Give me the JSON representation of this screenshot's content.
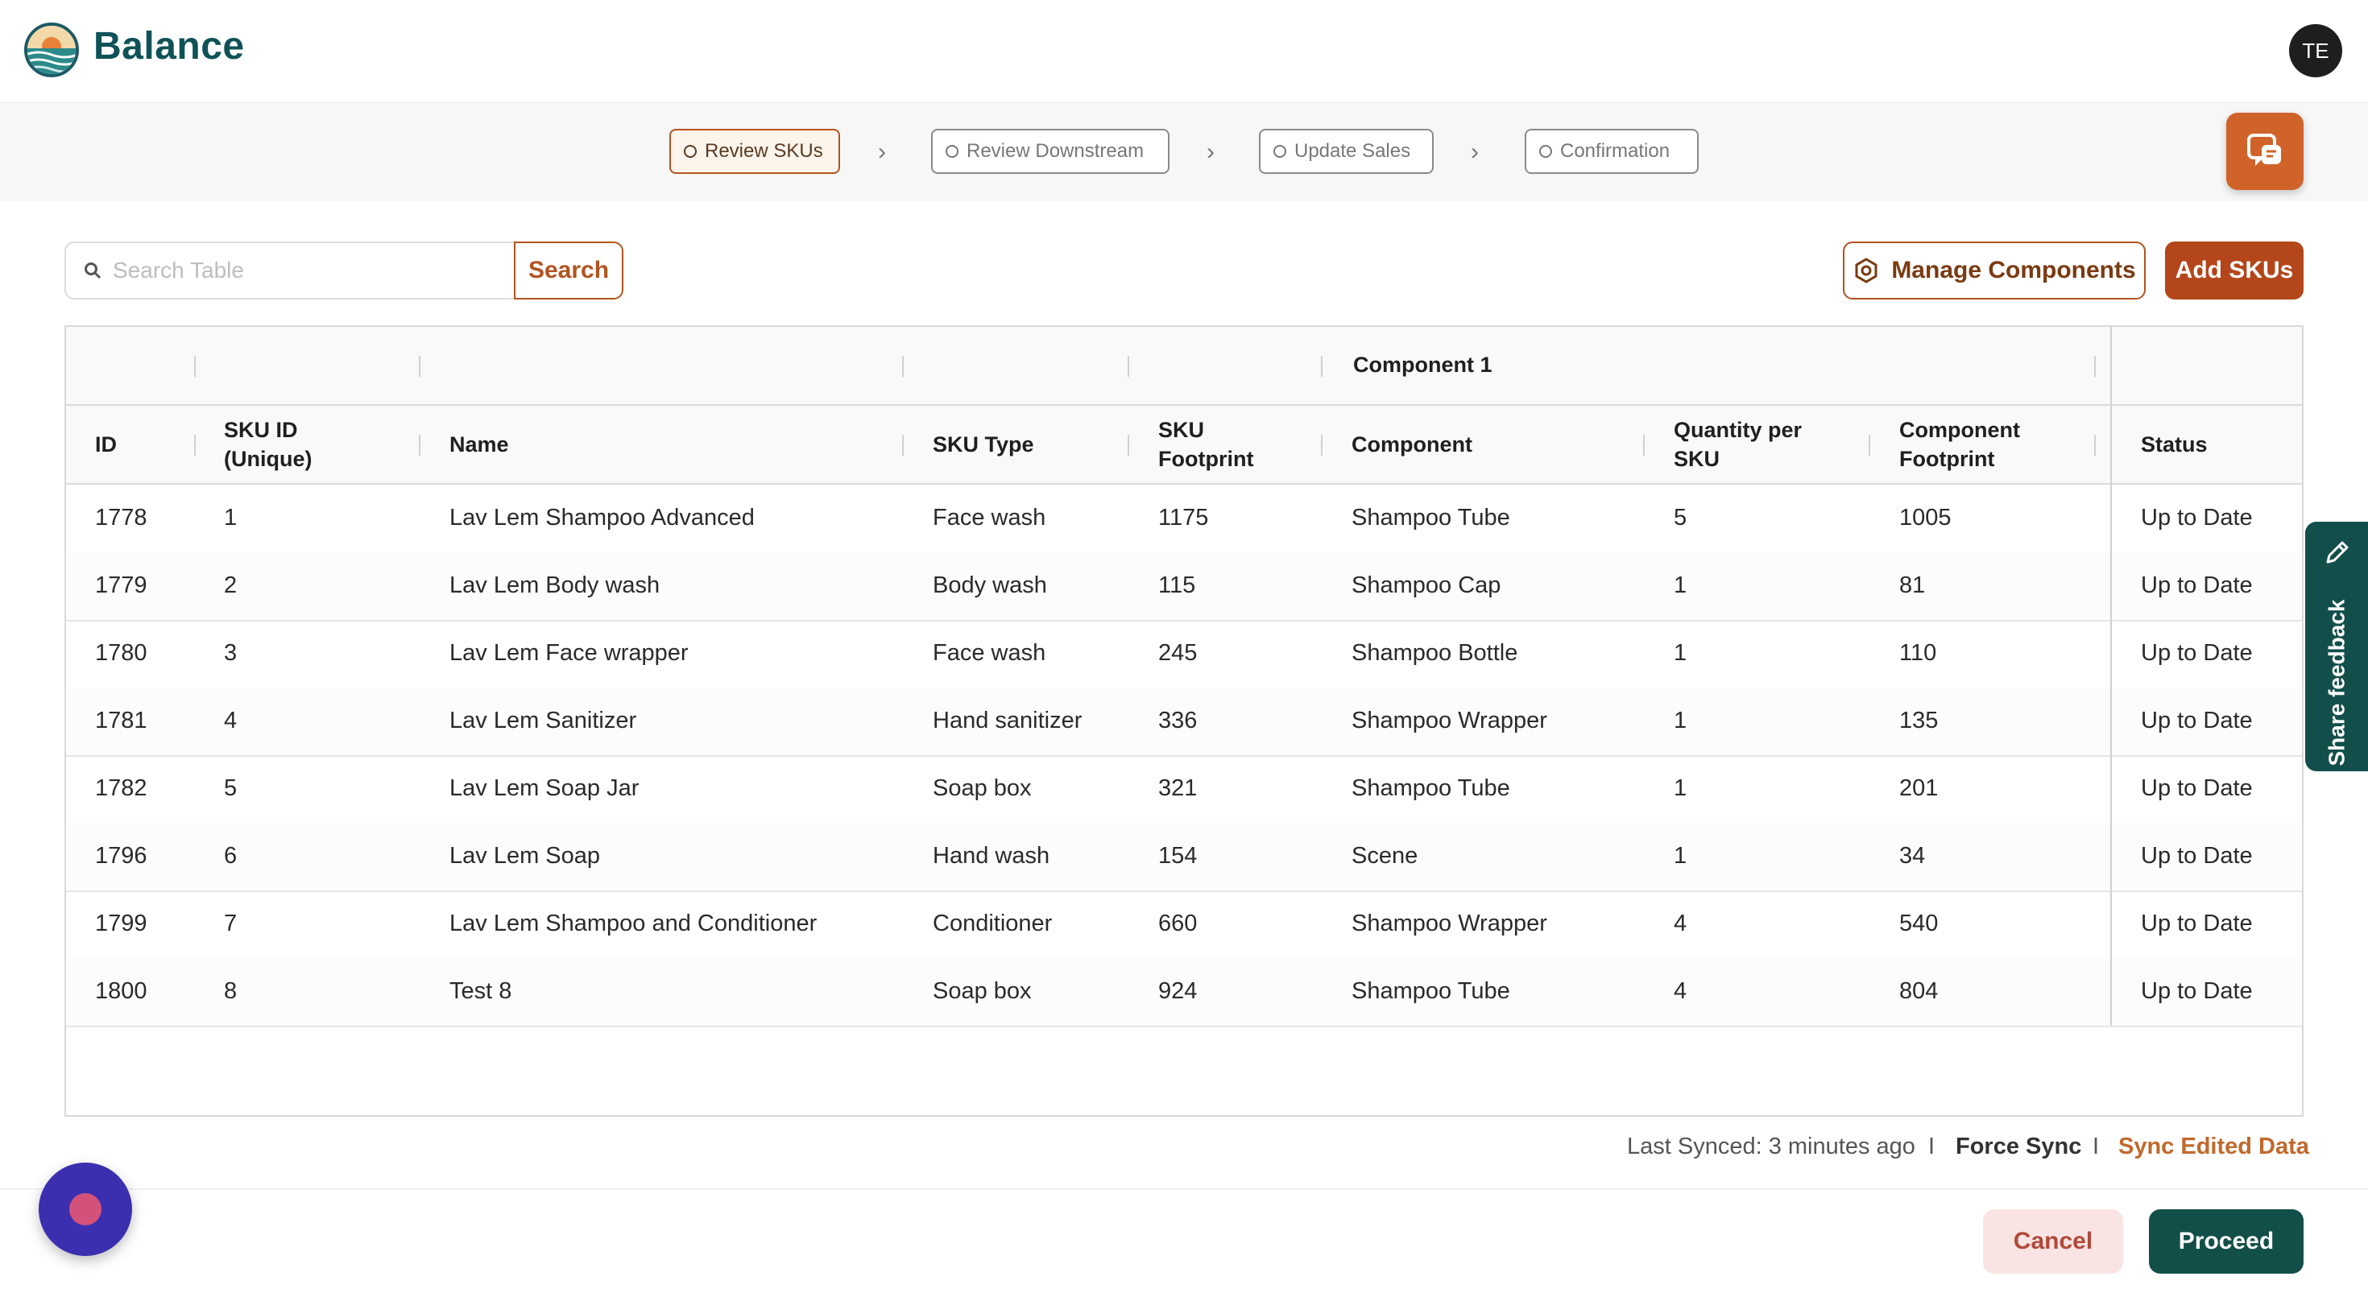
{
  "app": {
    "brand": "Balance",
    "user_initials": "TE"
  },
  "steps": [
    {
      "label": "Review SKUs",
      "active": true
    },
    {
      "label": "Review Downstream",
      "active": false
    },
    {
      "label": "Update Sales",
      "active": false
    },
    {
      "label": "Confirmation",
      "active": false
    }
  ],
  "toolbar": {
    "search_placeholder": "Search Table",
    "search_label": "Search",
    "manage_label": "Manage Components",
    "add_label": "Add SKUs"
  },
  "table": {
    "group_header": "Component 1",
    "columns": [
      "ID",
      "SKU ID (Unique)",
      "Name",
      "SKU Type",
      "SKU Footprint",
      "Component",
      "Quantity per SKU",
      "Component Footprint",
      "Status"
    ],
    "column_lines": [
      [
        "ID"
      ],
      [
        "SKU ID",
        "(Unique)"
      ],
      [
        "Name"
      ],
      [
        "SKU Type"
      ],
      [
        "SKU",
        "Footprint"
      ],
      [
        "Component"
      ],
      [
        "Quantity per",
        "SKU"
      ],
      [
        "Component",
        "Footprint"
      ],
      [
        "Status"
      ]
    ],
    "rows": [
      [
        "1778",
        "1",
        "Lav Lem Shampoo Advanced",
        "Face wash",
        "1175",
        "Shampoo Tube",
        "5",
        "1005",
        "Up to Date"
      ],
      [
        "1779",
        "2",
        "Lav Lem Body wash",
        "Body wash",
        "115",
        "Shampoo Cap",
        "1",
        "81",
        "Up to Date"
      ],
      [
        "1780",
        "3",
        "Lav Lem Face wrapper",
        "Face wash",
        "245",
        "Shampoo Bottle",
        "1",
        "110",
        "Up to Date"
      ],
      [
        "1781",
        "4",
        "Lav Lem Sanitizer",
        "Hand sanitizer",
        "336",
        "Shampoo Wrapper",
        "1",
        "135",
        "Up to Date"
      ],
      [
        "1782",
        "5",
        "Lav Lem Soap Jar",
        "Soap box",
        "321",
        "Shampoo Tube",
        "1",
        "201",
        "Up to Date"
      ],
      [
        "1796",
        "6",
        "Lav Lem Soap",
        "Hand wash",
        "154",
        "Scene",
        "1",
        "34",
        "Up to Date"
      ],
      [
        "1799",
        "7",
        "Lav Lem Shampoo and Conditioner",
        "Conditioner",
        "660",
        "Shampoo Wrapper",
        "4",
        "540",
        "Up to Date"
      ],
      [
        "1800",
        "8",
        "Test 8",
        "Soap box",
        "924",
        "Shampoo Tube",
        "4",
        "804",
        "Up to Date"
      ]
    ]
  },
  "sync": {
    "last_synced": "Last Synced: 3 minutes ago",
    "separator": "I",
    "force_sync": "Force Sync",
    "sync_edited": "Sync Edited Data"
  },
  "actions": {
    "cancel": "Cancel",
    "proceed": "Proceed"
  },
  "feedback": {
    "label": "Share feedback"
  },
  "icons": {
    "logo": "balance-logo",
    "search": "search-icon",
    "manage": "hexagon-settings-icon",
    "chat": "chat-bubble-icon",
    "feedback": "pencil-icon",
    "assistant": "assistant-bubble-icon"
  },
  "colors": {
    "brand": "#0f5257",
    "accent": "#b3531f",
    "primary_dark": "#124f49",
    "assistant": "#3b2fb0"
  }
}
